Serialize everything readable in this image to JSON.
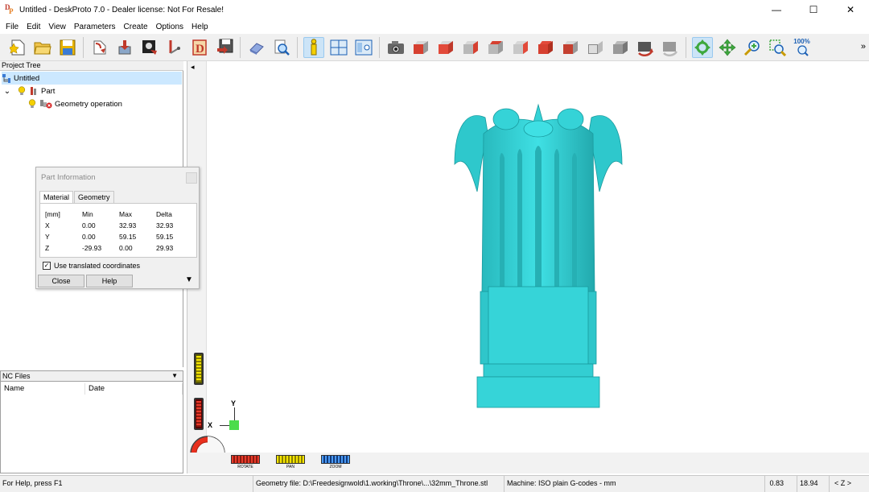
{
  "window": {
    "title": "Untitled - DeskProto 7.0 - Dealer license: Not For Resale!",
    "controls": {
      "minimize": "—",
      "maximize": "☐",
      "close": "✕"
    }
  },
  "menu": [
    "File",
    "Edit",
    "View",
    "Parameters",
    "Create",
    "Options",
    "Help"
  ],
  "toolbar": {
    "zoom_label": "100%",
    "overflow": "»"
  },
  "project_tree": {
    "header": "Project Tree",
    "root": "Untitled",
    "part": "Part",
    "operation": "Geometry operation",
    "expander": "⌄"
  },
  "nc_files": {
    "header": "NC Files",
    "dropdown": "▼",
    "columns": [
      "Name",
      "Date"
    ]
  },
  "dialog": {
    "title": "Part Information",
    "tabs": [
      "Material",
      "Geometry"
    ],
    "headers": [
      "[mm]",
      "Min",
      "Max",
      "Delta"
    ],
    "rows": [
      {
        "axis": "X",
        "min": "0.00",
        "max": "32.93",
        "delta": "32.93"
      },
      {
        "axis": "Y",
        "min": "0.00",
        "max": "59.15",
        "delta": "59.15"
      },
      {
        "axis": "Z",
        "min": "-29.93",
        "max": "0.00",
        "delta": "29.93"
      }
    ],
    "checkbox_label": "Use translated coordinates",
    "checkbox_mark": "✓",
    "close_button": "Close",
    "help_button": "Help",
    "more": "▼"
  },
  "viewport": {
    "collapse_arrow": "◂",
    "axis_y": "Y",
    "axis_x": "X",
    "controls": [
      "ROTATE",
      "PAN",
      "ZOOM"
    ],
    "model_color": "#36d4d8"
  },
  "status": {
    "help": "For Help, press F1",
    "geometry": "Geometry file: D:\\Freedesignwold\\1.working\\Throne\\...\\32mm_Throne.stl",
    "machine": "Machine: ISO plain G-codes - mm",
    "val1": "0.83",
    "val2": "18.94",
    "axis": "< Z >"
  }
}
